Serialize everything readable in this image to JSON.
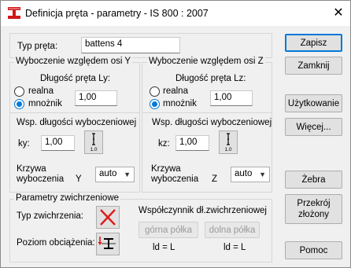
{
  "window": {
    "title": "Definicja pręta - parametry - IS 800 : 2007",
    "close": "✕"
  },
  "member_type": {
    "label": "Typ pręta:",
    "value": "battens 4"
  },
  "buckling_y": {
    "title": "Wyboczenie względem osi Y",
    "length_label": "Długość pręta Ly:",
    "opt_real": "realna",
    "opt_factor": "mnożnik",
    "value": "1,00",
    "coeff_label": "Wsp. długości wyboczeniowej",
    "k_label": "ky:",
    "k_value": "1,00",
    "k_icon_text": "1.0",
    "curve_label_1": "Krzywa",
    "curve_label_2": "wyboczenia",
    "curve_axis": "Y",
    "curve_value": "auto"
  },
  "buckling_z": {
    "title": "Wyboczenie względem osi Z",
    "length_label": "Długość pręta Lz:",
    "opt_real": "realna",
    "opt_factor": "mnożnik",
    "value": "1,00",
    "coeff_label": "Wsp. długości wyboczeniowej",
    "k_label": "kz:",
    "k_value": "1,00",
    "k_icon_text": "1.0",
    "curve_label_1": "Krzywa",
    "curve_label_2": "wyboczenia",
    "curve_axis": "Z",
    "curve_value": "auto"
  },
  "lateral": {
    "title": "Parametry zwichrzeniowe",
    "type_label": "Typ zwichrzenia:",
    "load_level_label": "Poziom obciążenia:",
    "coeff_title": "Współczynnik dł.zwichrzeniowej",
    "upper_flange": "górna półka",
    "lower_flange": "dolna półka",
    "ld_upper": "ld = L",
    "ld_lower": "ld = L"
  },
  "buttons": {
    "save": "Zapisz",
    "close": "Zamknij",
    "service": "Użytkowanie",
    "more": "Więcej...",
    "ribs": "Żebra",
    "composite_1": "Przekrój",
    "composite_2": "złożony",
    "help": "Pomoc"
  },
  "colors": {
    "accent": "#0078d7",
    "cross": "#e01b1b"
  }
}
